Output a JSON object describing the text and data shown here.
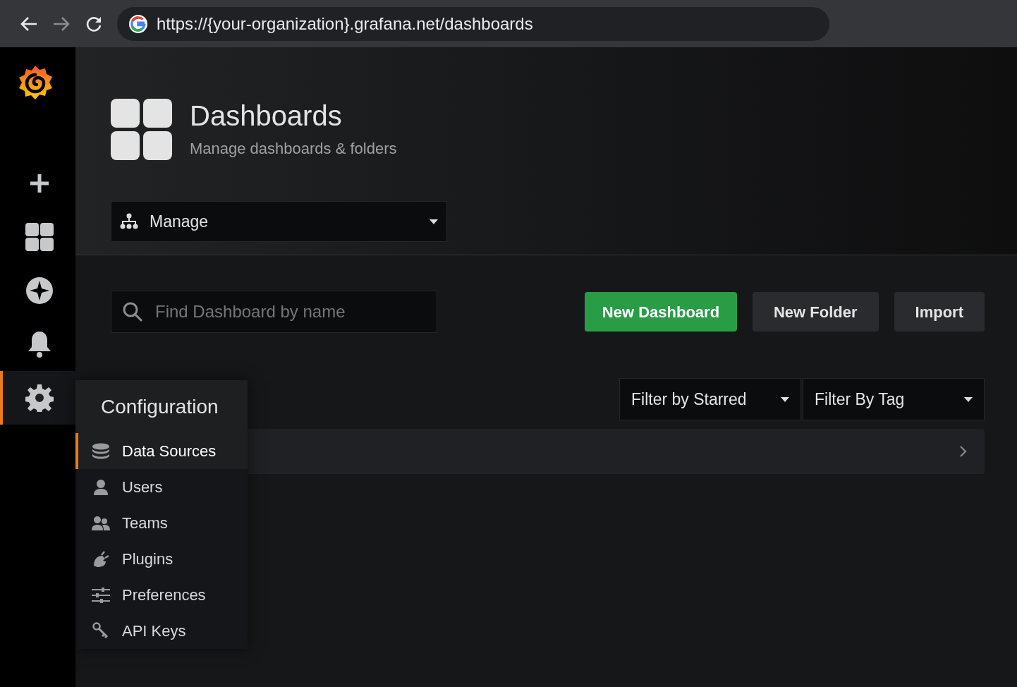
{
  "browser": {
    "url": "https://{your-organization}.grafana.net/dashboards"
  },
  "sidebar": {
    "items": [
      {
        "kind": "create",
        "selected": false
      },
      {
        "kind": "dashboards",
        "selected": false
      },
      {
        "kind": "explore",
        "selected": false
      },
      {
        "kind": "alerting",
        "selected": false
      },
      {
        "kind": "configuration",
        "selected": true
      }
    ]
  },
  "header": {
    "title": "Dashboards",
    "subtitle": "Manage dashboards & folders",
    "nav_dropdown": "Manage"
  },
  "search": {
    "placeholder": "Find Dashboard by name"
  },
  "buttons": [
    {
      "label": "New Dashboard",
      "kind": "primary"
    },
    {
      "label": "New Folder",
      "kind": "secondary"
    },
    {
      "label": "Import",
      "kind": "secondary"
    }
  ],
  "filters": [
    "Filter by Starred",
    "Filter By Tag"
  ],
  "folder_rows": [
    {
      "expanded": false
    }
  ],
  "config_menu": {
    "title": "Configuration",
    "items": [
      {
        "label": "Data Sources",
        "kind": "database",
        "selected": true
      },
      {
        "label": "Users",
        "kind": "user",
        "selected": false
      },
      {
        "label": "Teams",
        "kind": "team",
        "selected": false
      },
      {
        "label": "Plugins",
        "kind": "plug",
        "selected": false
      },
      {
        "label": "Preferences",
        "kind": "sliders",
        "selected": false
      },
      {
        "label": "API Keys",
        "kind": "key",
        "selected": false
      }
    ]
  }
}
